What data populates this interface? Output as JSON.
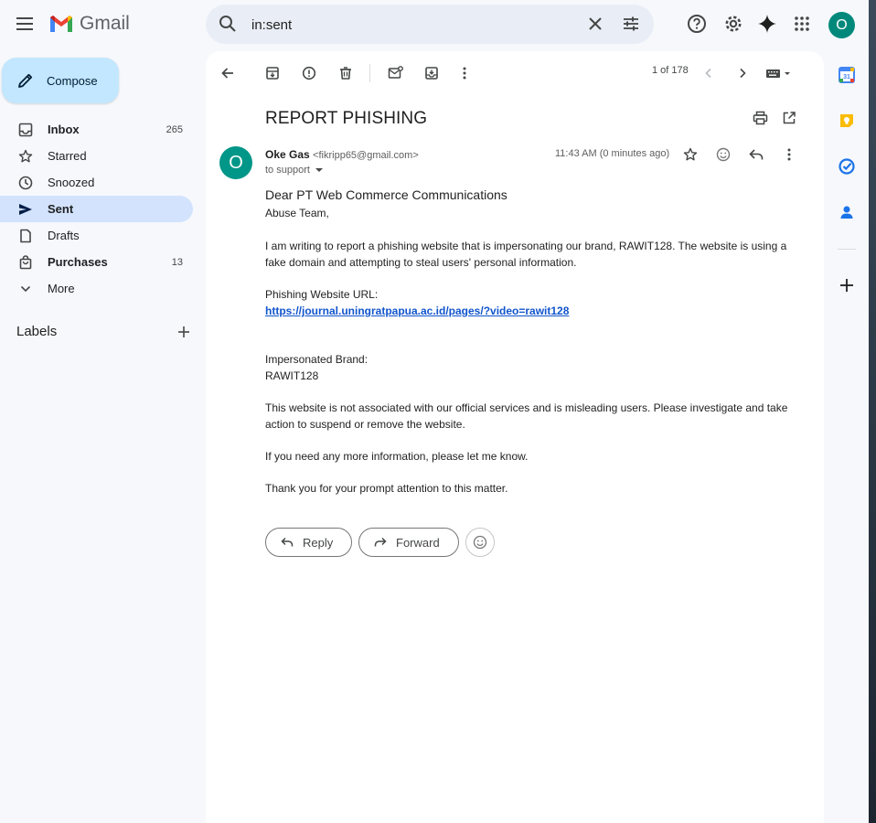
{
  "app": {
    "name": "Gmail"
  },
  "search": {
    "query": "in:sent"
  },
  "account": {
    "initial": "O"
  },
  "compose": {
    "label": "Compose"
  },
  "nav": [
    {
      "label": "Inbox",
      "count": "265",
      "bold": true
    },
    {
      "label": "Starred",
      "count": ""
    },
    {
      "label": "Snoozed",
      "count": ""
    },
    {
      "label": "Sent",
      "count": "",
      "active": true,
      "bold": true
    },
    {
      "label": "Drafts",
      "count": ""
    },
    {
      "label": "Purchases",
      "count": "13",
      "bold": true
    },
    {
      "label": "More",
      "count": ""
    }
  ],
  "labels": {
    "title": "Labels"
  },
  "pager": {
    "text": "1 of 178"
  },
  "email": {
    "subject": "REPORT PHISHING",
    "sender_initial": "O",
    "sender_name": "Oke Gas",
    "sender_email": "<fikripp65@gmail.com>",
    "to": "to support",
    "timestamp": "11:43 AM (0 minutes ago)",
    "greeting": "Dear PT Web Commerce Communications",
    "line_team": "Abuse Team,",
    "para1": "I am writing to report a phishing website that is impersonating our brand, RAWIT128. The website is using a fake domain and attempting to steal users' personal information.",
    "url_label": "Phishing Website URL:",
    "url": "https://journal.uningratpapua.ac.id/pages/?video=rawit128",
    "brand_label": "Impersonated Brand:",
    "brand": "RAWIT128",
    "para2": "This website is not associated with our official services and is misleading users. Please investigate and take action to suspend or remove the website.",
    "para3": "If you need any more information, please let me know.",
    "para4": "Thank you for your prompt attention to this matter."
  },
  "actions": {
    "reply": "Reply",
    "forward": "Forward"
  },
  "colors": {
    "accent": "#c2e7ff",
    "active_nav": "#d3e3fd",
    "avatar": "#009688",
    "link": "#1155cc"
  }
}
